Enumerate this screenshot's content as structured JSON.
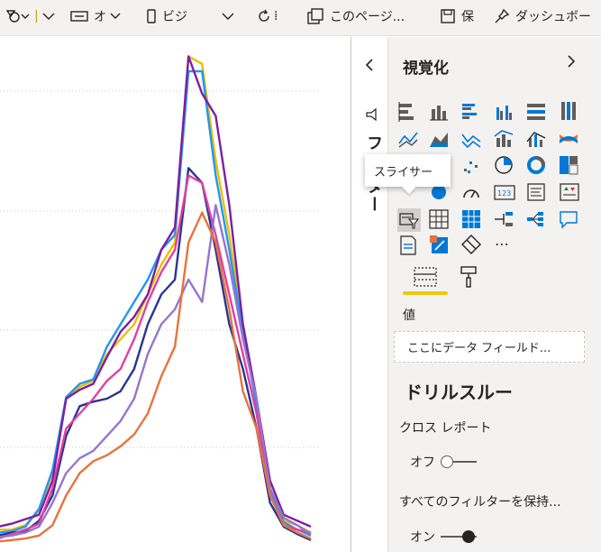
{
  "toolbar": {
    "items": [
      {
        "label": "",
        "icon": "shapes-icon"
      },
      {
        "label": "オ",
        "icon": "button-icon"
      },
      {
        "label": "ビジ",
        "icon": "phone-icon"
      },
      {
        "label": "",
        "icon": "refresh-icon"
      },
      {
        "label": "このページ...",
        "icon": "duplicate-page-icon"
      },
      {
        "label": "保",
        "icon": "save-icon"
      },
      {
        "label": "ダッシュボー",
        "icon": "pin-icon"
      }
    ]
  },
  "filters_pane": {
    "label": "フィ ター"
  },
  "visualizations": {
    "title": "視覚化",
    "tooltip": "スライサー",
    "more": "⋯",
    "values_label": "値",
    "values_placeholder": "ここにデータ フィールド...",
    "drill_through_title": "ドリルスルー",
    "cross_report_label": "クロス レポート",
    "cross_report_value": "オフ",
    "keep_filters_label": "すべてのフィルターを保持...",
    "keep_filters_value": "オン"
  },
  "accent_color": "#f2c811",
  "chart_data": {
    "type": "line",
    "series": [
      {
        "color": "#e8c000",
        "values": [
          12,
          12,
          15,
          25,
          50,
          100,
          108,
          112,
          130,
          140,
          150,
          170,
          190,
          205,
          330,
          325,
          260,
          210,
          150,
          100,
          40,
          18,
          15,
          10
        ]
      },
      {
        "color": "#2196f3",
        "values": [
          10,
          11,
          14,
          26,
          52,
          101,
          110,
          113,
          135,
          150,
          165,
          180,
          200,
          210,
          320,
          320,
          250,
          200,
          145,
          95,
          38,
          17,
          12,
          8
        ]
      },
      {
        "color": "#7b1fa2",
        "values": [
          14,
          16,
          19,
          22,
          45,
          100,
          106,
          110,
          128,
          145,
          155,
          170,
          200,
          215,
          330,
          305,
          290,
          230,
          150,
          100,
          45,
          22,
          18,
          14
        ]
      },
      {
        "color": "#283593",
        "values": [
          8,
          10,
          11,
          18,
          35,
          75,
          95,
          98,
          100,
          105,
          120,
          150,
          170,
          180,
          255,
          245,
          200,
          150,
          120,
          80,
          30,
          14,
          9,
          5
        ]
      },
      {
        "color": "#e040a0",
        "values": [
          6,
          9,
          12,
          16,
          40,
          80,
          90,
          100,
          112,
          120,
          140,
          165,
          185,
          200,
          250,
          245,
          210,
          170,
          130,
          90,
          35,
          15,
          12,
          10
        ]
      },
      {
        "color": "#9575cd",
        "values": [
          7,
          8,
          10,
          14,
          30,
          50,
          60,
          65,
          75,
          85,
          100,
          130,
          150,
          160,
          180,
          165,
          230,
          190,
          140,
          100,
          40,
          20,
          15,
          9
        ]
      },
      {
        "color": "#e8733a",
        "values": [
          4,
          5,
          6,
          8,
          15,
          35,
          50,
          58,
          62,
          68,
          76,
          90,
          115,
          135,
          205,
          225,
          205,
          160,
          105,
          80,
          35,
          15,
          10,
          6
        ]
      }
    ]
  }
}
